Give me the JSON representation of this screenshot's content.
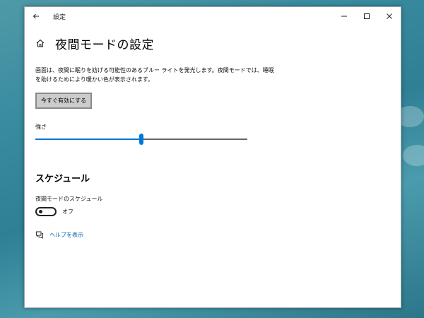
{
  "titlebar": {
    "title": "設定"
  },
  "header": {
    "page_title": "夜間モードの設定"
  },
  "description": "画面は、夜間に眠りを妨げる可能性のあるブルー ライトを発光します。夜間モードでは、睡眠を助けるためにより暖かい色が表示されます。",
  "enable_button": {
    "label": "今すぐ有効にする"
  },
  "strength": {
    "label": "強さ",
    "value": 0.5
  },
  "schedule": {
    "section_title": "スケジュール",
    "toggle_label": "夜間モードのスケジュール",
    "toggle_state": "オフ",
    "toggle_on": false
  },
  "help": {
    "link_label": "ヘルプを表示"
  },
  "colors": {
    "accent": "#0078d7",
    "link": "#0063b1"
  }
}
